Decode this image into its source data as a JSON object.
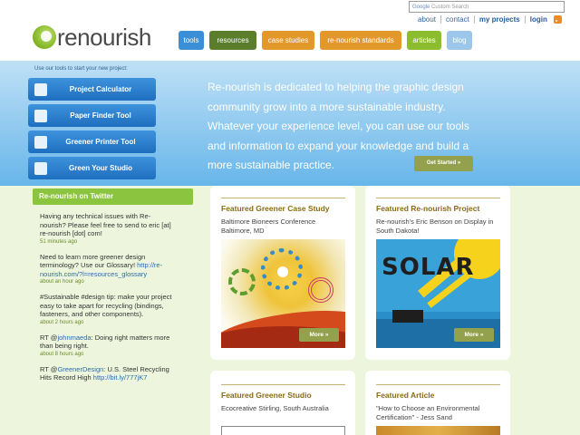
{
  "header": {
    "logo_text": "renourish",
    "search_brand": "Google",
    "search_placeholder": "Custom Search",
    "utility_links": [
      "about",
      "contact",
      "my projects",
      "login"
    ],
    "nav": [
      "tools",
      "resources",
      "case studies",
      "re-nourish standards",
      "articles",
      "blog"
    ],
    "colors": {
      "tools": "#3b8fd6",
      "resources": "#5a7e2b",
      "case_studies": "#e3982a",
      "standards": "#e3982a",
      "articles": "#8bbd2f",
      "blog": "#9cc7ea"
    }
  },
  "hero": {
    "intro": "Use our tools to start your new project:",
    "tools": [
      {
        "label": "Project Calculator",
        "icon": "calculator-icon"
      },
      {
        "label": "Paper Finder Tool",
        "icon": "paper-stack-icon"
      },
      {
        "label": "Greener Printer Tool",
        "icon": "printer-pen-icon"
      },
      {
        "label": "Green Your Studio",
        "icon": "studio-lamp-icon"
      }
    ],
    "mission": "Re-nourish is dedicated to helping the graphic design community grow into a more sustainable industry. Whatever your experience level, you can use our tools and information to expand your knowledge and build a more sustainable practice.",
    "cta": "Get Started »"
  },
  "twitter": {
    "heading": "Re-nourish on Twitter",
    "tweets": [
      {
        "text": "Having any technical issues with Re-nourish? Please feel free to send to eric [at] re-nourish [dot] com!",
        "time": "51 minutes ago"
      },
      {
        "text": "Need to learn more greener design terminology? Use our Glossary!",
        "link": "http://re-nourish.com/?l=resources_glossary",
        "time": "about an hour ago"
      },
      {
        "text": "#Sustainable #design tip: make your project easy to take apart for recycling (bindings, fasteners, and other components).",
        "time": "about 2 hours ago"
      },
      {
        "prefix": "RT @",
        "handle": "johnmaeda",
        "text": ": Doing right matters more than being right.",
        "time": "about 8 hours ago"
      },
      {
        "prefix": "RT @",
        "handle": "GreenerDesign",
        "text": ": U.S. Steel Recycling Hits Record High",
        "link": "http://bit.ly/777jK7",
        "time": ""
      }
    ]
  },
  "featured": {
    "case_study": {
      "title": "Featured Greener Case Study",
      "desc": "Baltimore Bioneers Conference Baltimore, MD",
      "more": "More »"
    },
    "project": {
      "title": "Featured Re-nourish Project",
      "desc": "Re-nourish's Eric Benson on Display in South Dakota!",
      "more": "More »",
      "image_word": "SOLAR"
    },
    "studio": {
      "title": "Featured Greener Studio",
      "desc": "Ecocreative Stirling, South Australia"
    },
    "article": {
      "title": "Featured Article",
      "desc": "\"How to Choose an Environmental Certification\" - Jess Sand"
    }
  }
}
